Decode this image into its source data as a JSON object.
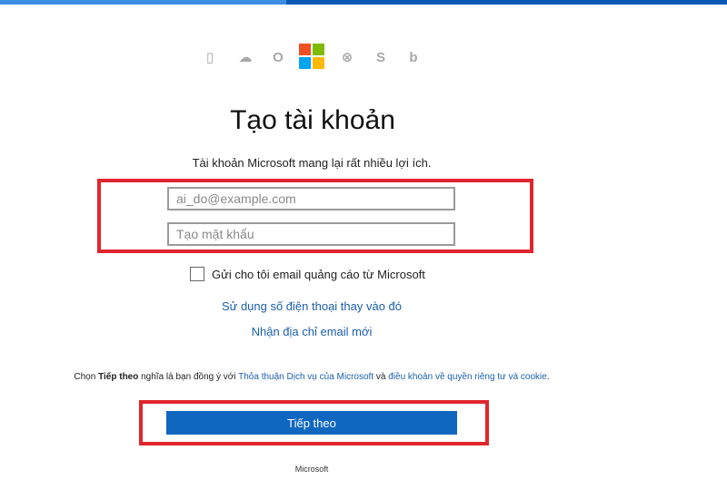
{
  "colors": {
    "accent": "#0f67c0",
    "link": "#1b5fae",
    "highlight": "#e0262d",
    "icon_gray": "#a7a7a7"
  },
  "product_icons": [
    {
      "name": "office-icon",
      "glyph": "▯"
    },
    {
      "name": "onedrive-icon",
      "glyph": "☁"
    },
    {
      "name": "outlook-icon",
      "glyph": "O"
    },
    {
      "name": "microsoft-logo-icon",
      "glyph": ""
    },
    {
      "name": "xbox-icon",
      "glyph": "⊗"
    },
    {
      "name": "skype-icon",
      "glyph": "S"
    },
    {
      "name": "bing-icon",
      "glyph": "b"
    }
  ],
  "ms_logo_colors": [
    "#f25022",
    "#7fba00",
    "#00a4ef",
    "#ffb900"
  ],
  "header": {
    "title": "Tạo tài khoản",
    "subtitle": "Tài khoản Microsoft mang lại rất nhiều lợi ích."
  },
  "form": {
    "email_placeholder": "ai_do@example.com",
    "email_value": "",
    "password_placeholder": "Tạo mật khẩu",
    "password_value": "",
    "checkbox_label": "Gửi cho tôi email quảng cáo từ Microsoft",
    "checkbox_checked": false
  },
  "links": {
    "use_phone": "Sử dụng số điện thoại thay vào đó",
    "new_email": "Nhận địa chỉ email mới"
  },
  "terms": {
    "prefix": "Chọn ",
    "bold": "Tiếp theo",
    "middle": " nghĩa là bạn đồng ý với ",
    "service_agreement_link": "Thỏa thuận Dịch vụ của Microsoft",
    "and": " và ",
    "privacy_link": "điều khoản về quyền riêng tư và cookie",
    "suffix": "."
  },
  "next_button": "Tiếp theo",
  "footer": "Microsoft"
}
